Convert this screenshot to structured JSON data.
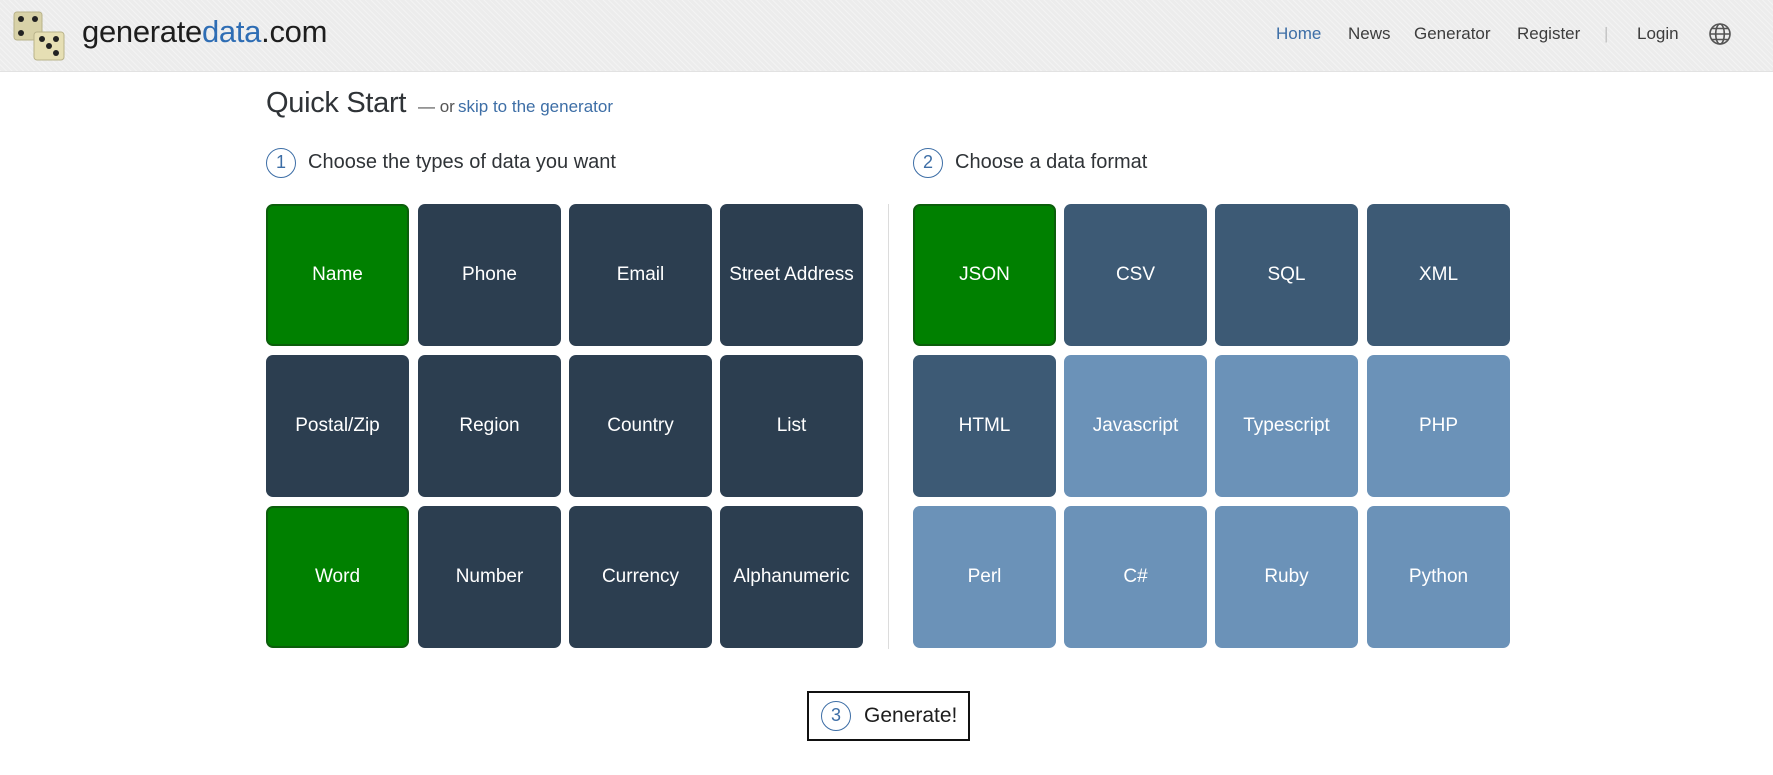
{
  "brand": {
    "part1": "generate",
    "part2": "data",
    "part3": ".com"
  },
  "nav": {
    "items": [
      "Home",
      "News",
      "Generator",
      "Register"
    ],
    "separator": "|",
    "login": "Login",
    "language_icon": "globe-icon"
  },
  "page": {
    "title": "Quick Start",
    "subtitle": "— or",
    "skip_link": "skip to the generator"
  },
  "step1": {
    "number": "1",
    "label": "Choose the types of data you want",
    "options": [
      {
        "label": "Name",
        "selected": true
      },
      {
        "label": "Phone",
        "selected": false
      },
      {
        "label": "Email",
        "selected": false
      },
      {
        "label": "Street Address",
        "selected": false
      },
      {
        "label": "Postal/Zip",
        "selected": false
      },
      {
        "label": "Region",
        "selected": false
      },
      {
        "label": "Country",
        "selected": false
      },
      {
        "label": "List",
        "selected": false
      },
      {
        "label": "Word",
        "selected": true
      },
      {
        "label": "Number",
        "selected": false
      },
      {
        "label": "Currency",
        "selected": false
      },
      {
        "label": "Alphanumeric",
        "selected": false
      }
    ]
  },
  "step2": {
    "number": "2",
    "label": "Choose a data format",
    "options": [
      {
        "label": "JSON",
        "selected": true
      },
      {
        "label": "CSV",
        "selected": false
      },
      {
        "label": "SQL",
        "selected": false
      },
      {
        "label": "XML",
        "selected": false
      },
      {
        "label": "HTML",
        "selected": false
      },
      {
        "label": "Javascript",
        "selected": false
      },
      {
        "label": "Typescript",
        "selected": false
      },
      {
        "label": "PHP",
        "selected": false
      },
      {
        "label": "Perl",
        "selected": false
      },
      {
        "label": "C#",
        "selected": false
      },
      {
        "label": "Ruby",
        "selected": false
      },
      {
        "label": "Python",
        "selected": false
      }
    ]
  },
  "step3": {
    "number": "3",
    "label": "Generate!"
  },
  "colors": {
    "selected": "#008000",
    "tile_dark": "#2c3e50",
    "tile_mid": "#3d5a75",
    "tile_light": "#6b92b8",
    "link": "#3d6ea6"
  }
}
